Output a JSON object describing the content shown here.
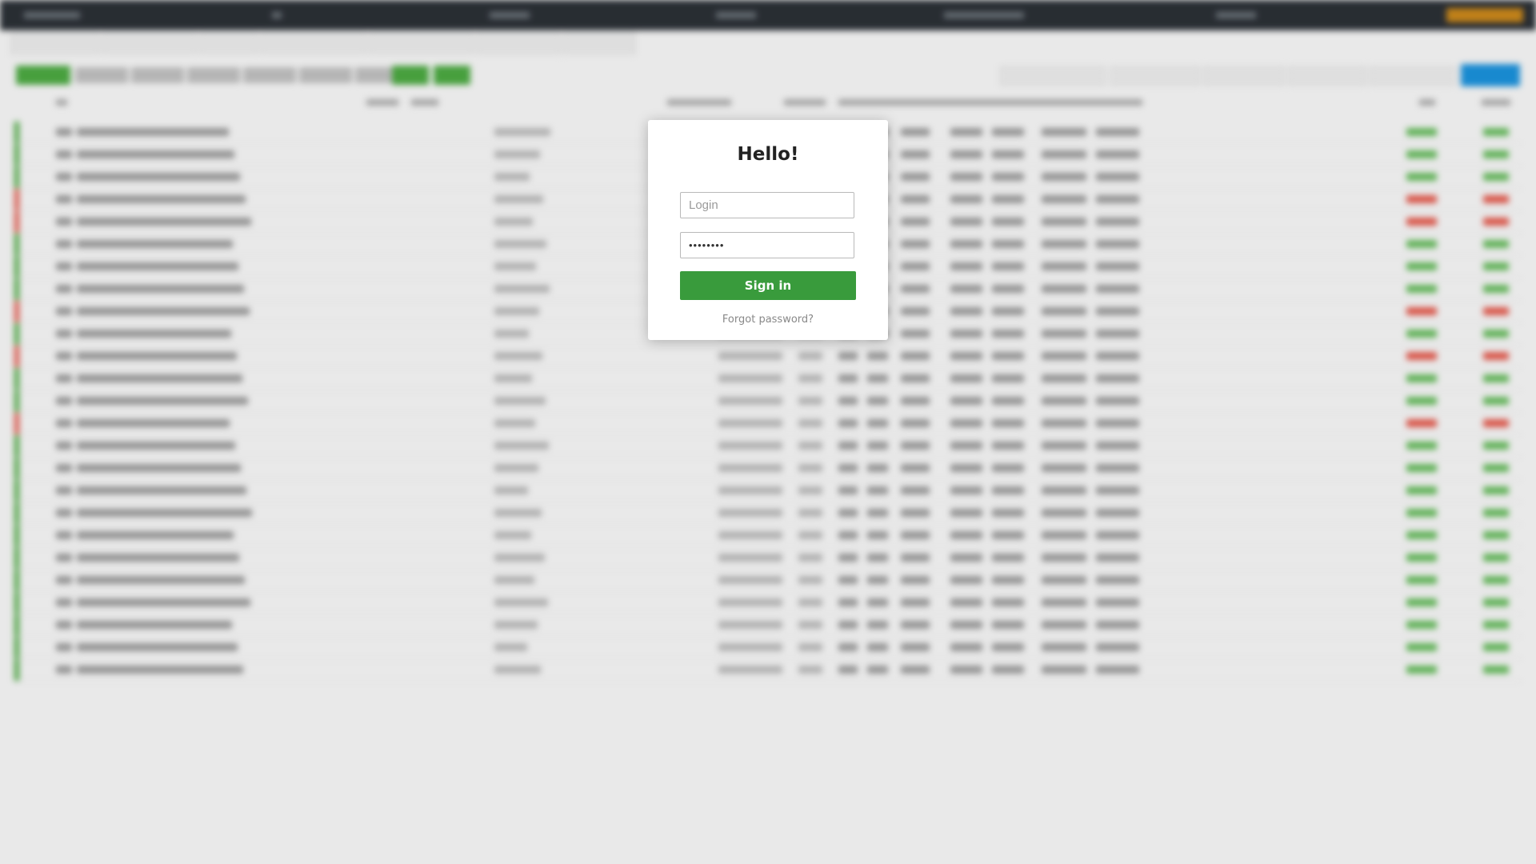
{
  "modal": {
    "title": "Hello!",
    "login_placeholder": "Login",
    "password_value": "••••••••",
    "signin_label": "Sign in",
    "forgot_label": "Forgot password?"
  },
  "colors": {
    "primary_green": "#399b3c",
    "topbar": "#2a2f35",
    "accent_blue": "#1a8fd8",
    "accent_orange": "#c7861b",
    "positive": "#4aa640",
    "negative": "#e0574a"
  }
}
